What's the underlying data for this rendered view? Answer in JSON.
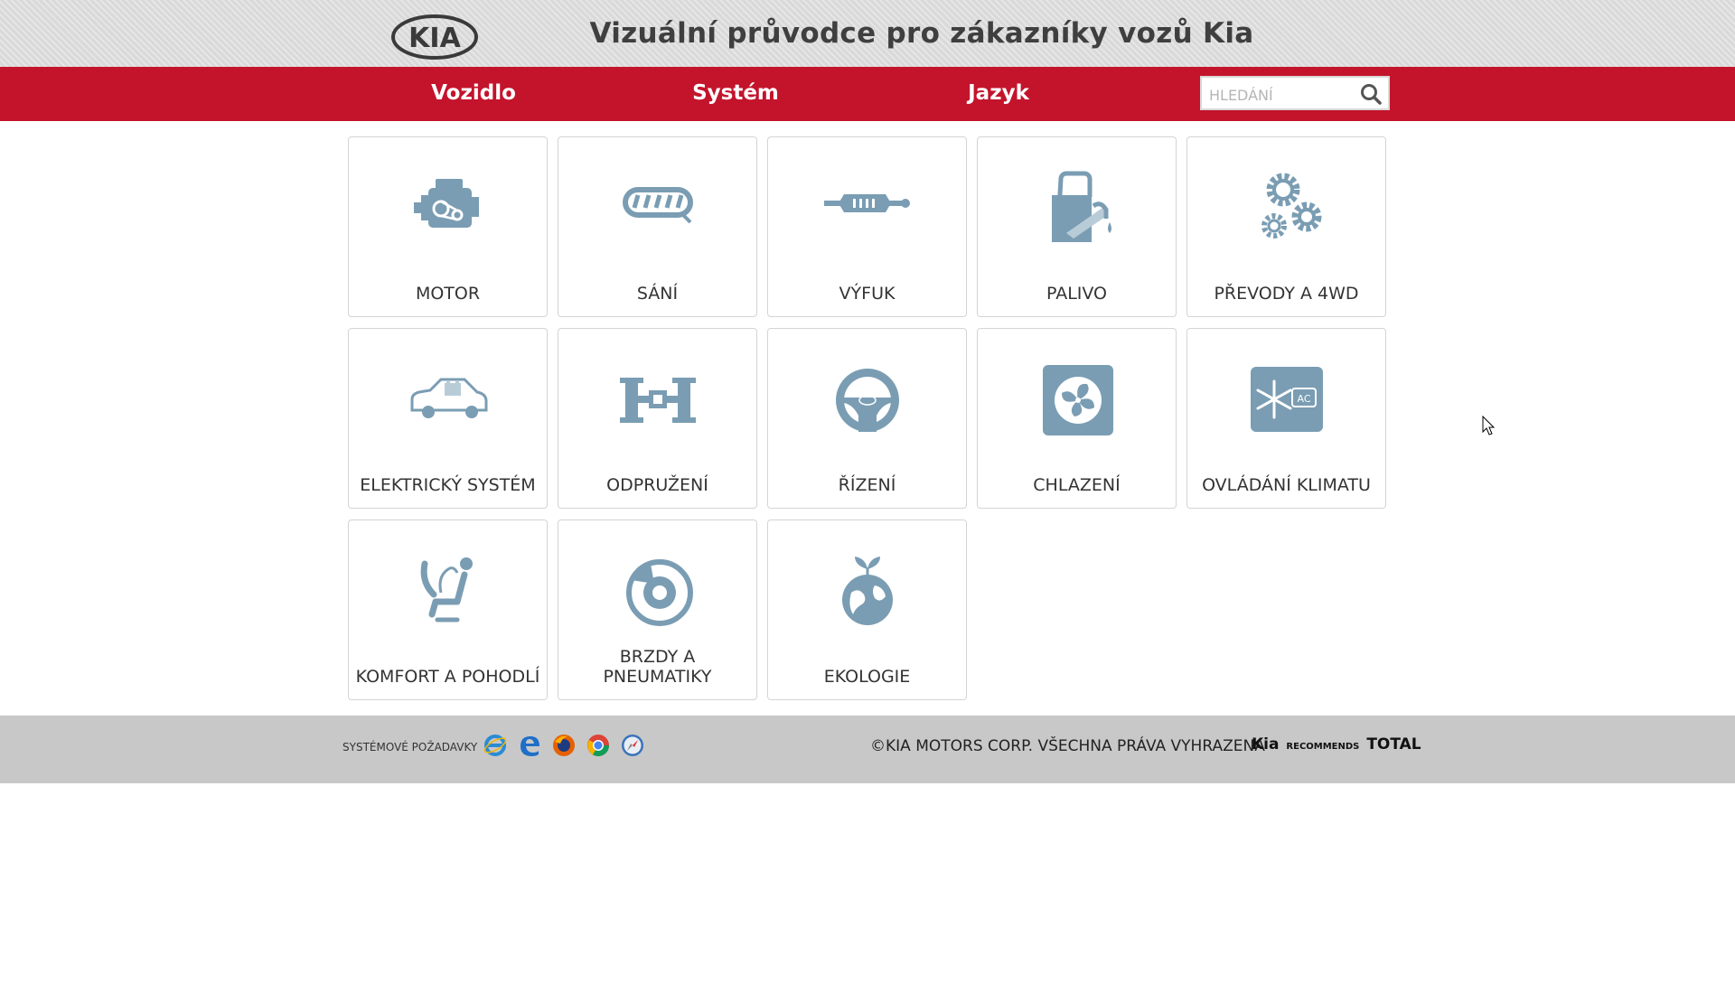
{
  "header": {
    "logo_text": "KIA",
    "title": "Vizuální průvodce pro zákazníky vozů Kia"
  },
  "nav": {
    "items": [
      {
        "label": "Vozidlo"
      },
      {
        "label": "Systém"
      },
      {
        "label": "Jazyk"
      }
    ],
    "search": {
      "placeholder": "HLEDÁNÍ",
      "icon": "search-icon"
    }
  },
  "tiles": [
    {
      "label": "MOTOR",
      "icon": "engine-icon"
    },
    {
      "label": "SÁNÍ",
      "icon": "intake-icon"
    },
    {
      "label": "VÝFUK",
      "icon": "exhaust-icon"
    },
    {
      "label": "PALIVO",
      "icon": "fuel-icon"
    },
    {
      "label": "PŘEVODY A 4WD",
      "icon": "gears-icon"
    },
    {
      "label": "ELEKTRICKÝ SYSTÉM",
      "icon": "car-battery-icon"
    },
    {
      "label": "ODPRUŽENÍ",
      "icon": "suspension-icon"
    },
    {
      "label": "ŘÍZENÍ",
      "icon": "steering-wheel-icon"
    },
    {
      "label": "CHLAZENÍ",
      "icon": "fan-icon"
    },
    {
      "label": "OVLÁDÁNÍ KLIMATU",
      "icon": "climate-ac-icon"
    },
    {
      "label": "KOMFORT A POHODLÍ",
      "icon": "seat-icon"
    },
    {
      "label": "BRZDY A PNEUMATIKY",
      "icon": "brake-disc-icon"
    },
    {
      "label": "EKOLOGIE",
      "icon": "eco-globe-icon"
    }
  ],
  "footer": {
    "system_requirements": "SYSTÉMOVÉ POŽADAVKY",
    "browsers": [
      "ie10-icon",
      "edge-icon",
      "firefox-icon",
      "chrome-icon",
      "safari-icon"
    ],
    "copyright": "©KIA MOTORS CORP. VŠECHNA PRÁVA VYHRAZENA",
    "partner_brand": "Kia",
    "partner_mid": "RECOMMENDS",
    "partner_name": "TOTAL"
  },
  "colors": {
    "accent_red": "#c3142c",
    "icon_blue": "#7a9db3",
    "header_gray": "#d9d9d9",
    "footer_gray": "#c8c8c8"
  }
}
